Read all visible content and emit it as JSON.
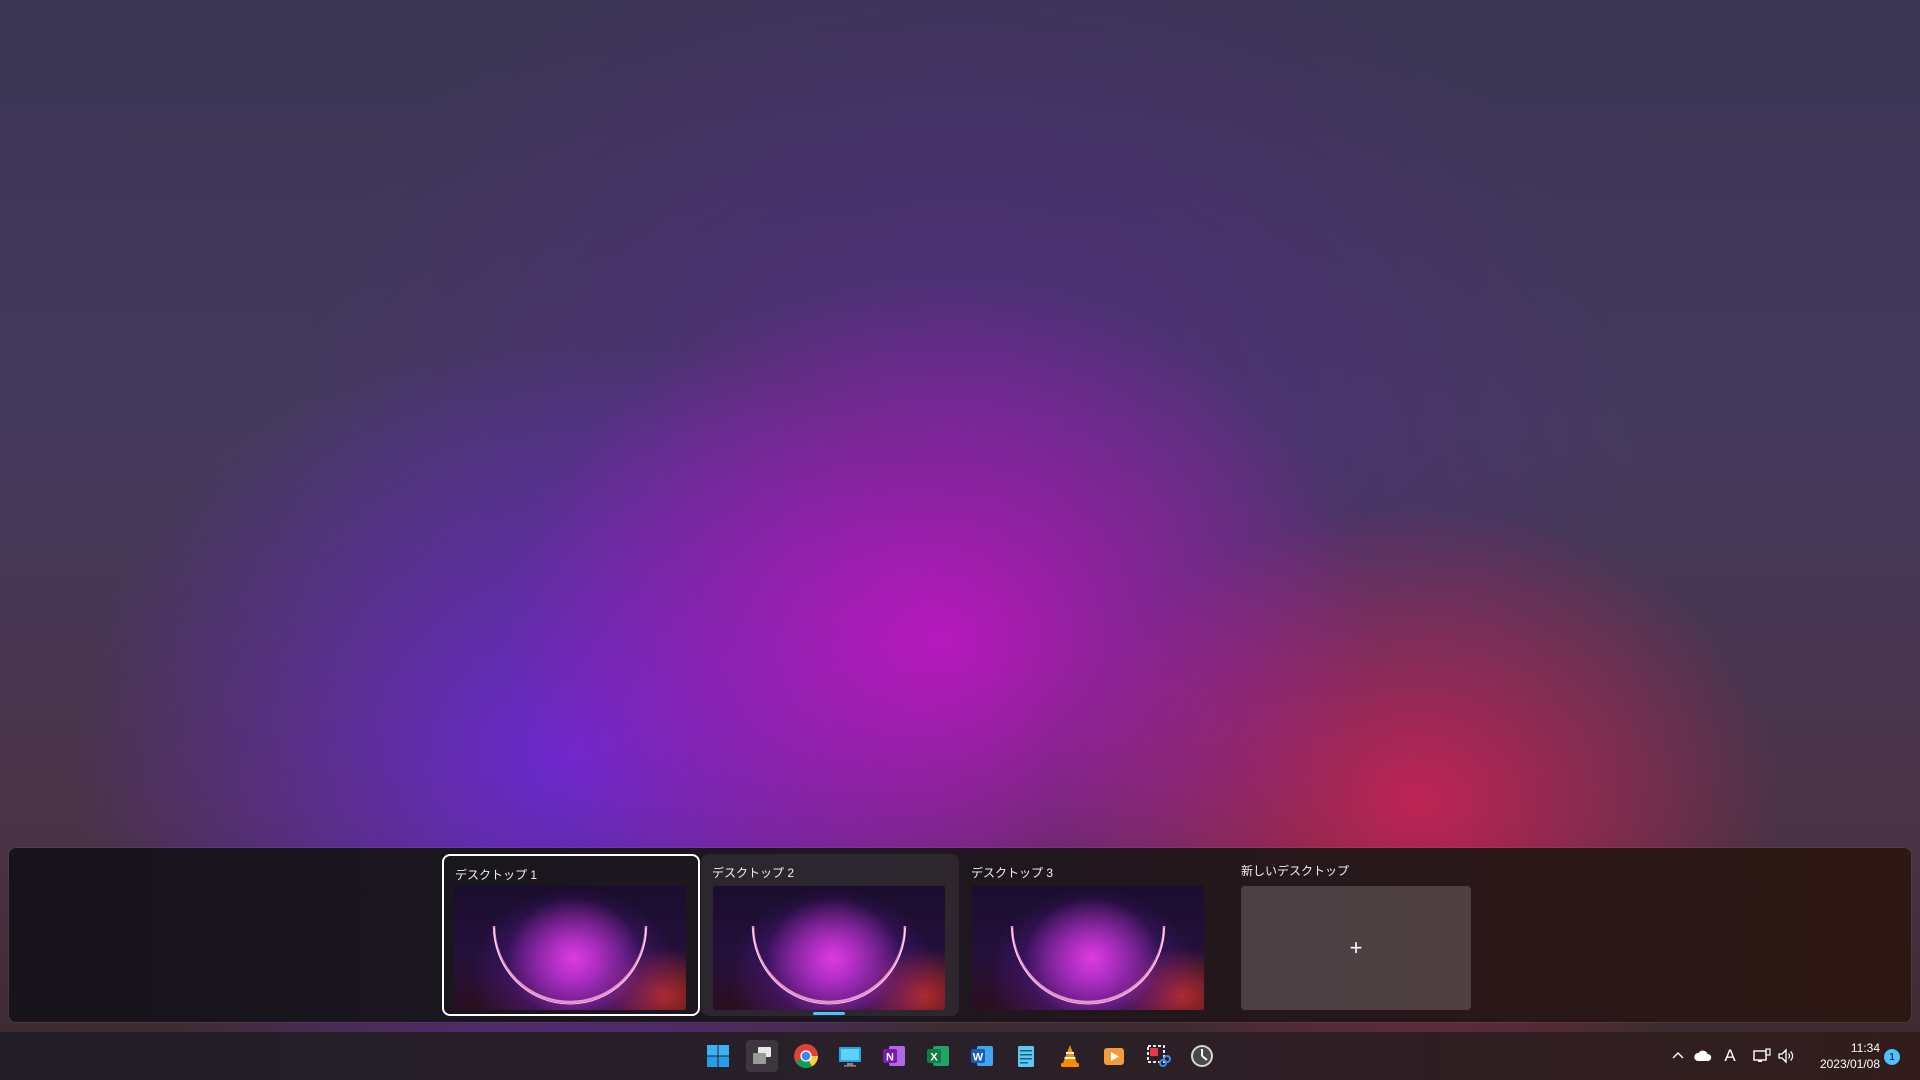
{
  "task_view": {
    "desktops": [
      {
        "label": "デスクトップ 1",
        "selected": true
      },
      {
        "label": "デスクトップ 2",
        "current": true
      },
      {
        "label": "デスクトップ 3"
      }
    ],
    "new_desktop_label": "新しいデスクトップ",
    "new_desktop_plus": "+"
  },
  "taskbar": {
    "pinned_icons": [
      "windows-start-icon",
      "task-view-icon",
      "chrome-icon",
      "remote-desktop-icon",
      "onenote-icon",
      "excel-icon",
      "word-icon",
      "notepad-icon",
      "vlc-icon",
      "media-player-icon",
      "snipping-tool-icon",
      "clock-app-icon"
    ],
    "onenote_letter": "N",
    "excel_letter": "X",
    "word_letter": "W",
    "tray": {
      "ime_mode": "A"
    },
    "clock_time": "11:34",
    "clock_date": "2023/01/08",
    "notification_count": "1"
  },
  "colors": {
    "accent": "#4cc2ff",
    "selection_border": "#ffffff"
  }
}
